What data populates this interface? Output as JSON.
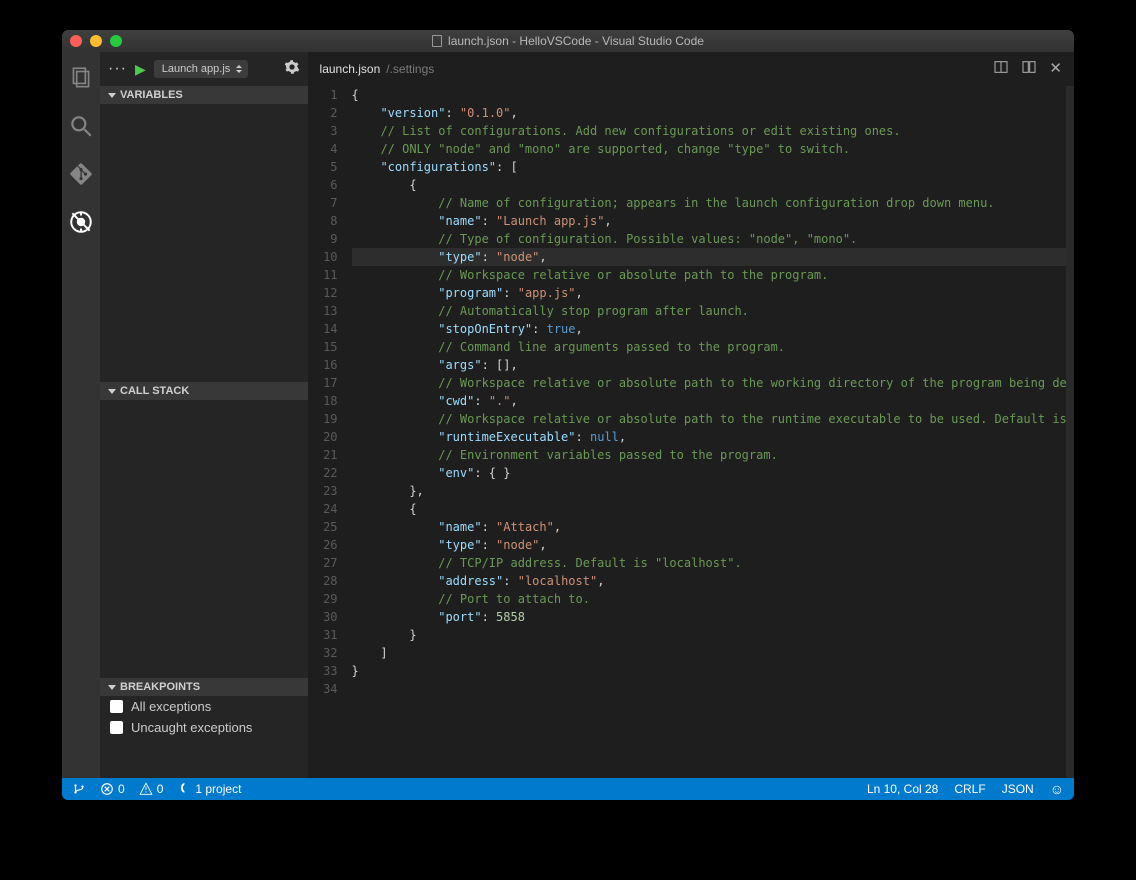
{
  "window": {
    "title": "launch.json - HelloVSCode - Visual Studio Code",
    "file_in_title": "launch.json"
  },
  "debugToolbar": {
    "configName": "Launch app.js"
  },
  "panels": {
    "variables": "VARIABLES",
    "callstack": "CALL STACK",
    "breakpoints": "BREAKPOINTS"
  },
  "breakpoints": [
    {
      "label": "All exceptions"
    },
    {
      "label": "Uncaught exceptions"
    }
  ],
  "editor": {
    "tabName": "launch.json",
    "tabPath": "/.settings",
    "highlightedLine": 10,
    "lines": [
      {
        "n": 1,
        "t": [
          {
            "c": "p",
            "v": "{"
          }
        ]
      },
      {
        "n": 2,
        "t": [
          {
            "c": "p",
            "v": "    "
          },
          {
            "c": "k",
            "v": "\"version\""
          },
          {
            "c": "p",
            "v": ": "
          },
          {
            "c": "s",
            "v": "\"0.1.0\""
          },
          {
            "c": "p",
            "v": ","
          }
        ]
      },
      {
        "n": 3,
        "t": [
          {
            "c": "p",
            "v": "    "
          },
          {
            "c": "c",
            "v": "// List of configurations. Add new configurations or edit existing ones."
          }
        ]
      },
      {
        "n": 4,
        "t": [
          {
            "c": "p",
            "v": "    "
          },
          {
            "c": "c",
            "v": "// ONLY \"node\" and \"mono\" are supported, change \"type\" to switch."
          }
        ]
      },
      {
        "n": 5,
        "t": [
          {
            "c": "p",
            "v": "    "
          },
          {
            "c": "k",
            "v": "\"configurations\""
          },
          {
            "c": "p",
            "v": ": ["
          }
        ]
      },
      {
        "n": 6,
        "t": [
          {
            "c": "p",
            "v": "        {"
          }
        ]
      },
      {
        "n": 7,
        "t": [
          {
            "c": "p",
            "v": "            "
          },
          {
            "c": "c",
            "v": "// Name of configuration; appears in the launch configuration drop down menu."
          }
        ]
      },
      {
        "n": 8,
        "t": [
          {
            "c": "p",
            "v": "            "
          },
          {
            "c": "k",
            "v": "\"name\""
          },
          {
            "c": "p",
            "v": ": "
          },
          {
            "c": "s",
            "v": "\"Launch app.js\""
          },
          {
            "c": "p",
            "v": ","
          }
        ]
      },
      {
        "n": 9,
        "t": [
          {
            "c": "p",
            "v": "            "
          },
          {
            "c": "c",
            "v": "// Type of configuration. Possible values: \"node\", \"mono\"."
          }
        ]
      },
      {
        "n": 10,
        "t": [
          {
            "c": "p",
            "v": "            "
          },
          {
            "c": "k",
            "v": "\"type\""
          },
          {
            "c": "p",
            "v": ": "
          },
          {
            "c": "s",
            "v": "\"node\""
          },
          {
            "c": "p",
            "v": ","
          }
        ]
      },
      {
        "n": 11,
        "t": [
          {
            "c": "p",
            "v": "            "
          },
          {
            "c": "c",
            "v": "// Workspace relative or absolute path to the program."
          }
        ]
      },
      {
        "n": 12,
        "t": [
          {
            "c": "p",
            "v": "            "
          },
          {
            "c": "k",
            "v": "\"program\""
          },
          {
            "c": "p",
            "v": ": "
          },
          {
            "c": "s",
            "v": "\"app.js\""
          },
          {
            "c": "p",
            "v": ","
          }
        ]
      },
      {
        "n": 13,
        "t": [
          {
            "c": "p",
            "v": "            "
          },
          {
            "c": "c",
            "v": "// Automatically stop program after launch."
          }
        ]
      },
      {
        "n": 14,
        "t": [
          {
            "c": "p",
            "v": "            "
          },
          {
            "c": "k",
            "v": "\"stopOnEntry\""
          },
          {
            "c": "p",
            "v": ": "
          },
          {
            "c": "b",
            "v": "true"
          },
          {
            "c": "p",
            "v": ","
          }
        ]
      },
      {
        "n": 15,
        "t": [
          {
            "c": "p",
            "v": "            "
          },
          {
            "c": "c",
            "v": "// Command line arguments passed to the program."
          }
        ]
      },
      {
        "n": 16,
        "t": [
          {
            "c": "p",
            "v": "            "
          },
          {
            "c": "k",
            "v": "\"args\""
          },
          {
            "c": "p",
            "v": ": [],"
          }
        ]
      },
      {
        "n": 17,
        "t": [
          {
            "c": "p",
            "v": "            "
          },
          {
            "c": "c",
            "v": "// Workspace relative or absolute path to the working directory of the program being deb"
          }
        ]
      },
      {
        "n": 18,
        "t": [
          {
            "c": "p",
            "v": "            "
          },
          {
            "c": "k",
            "v": "\"cwd\""
          },
          {
            "c": "p",
            "v": ": "
          },
          {
            "c": "s",
            "v": "\".\""
          },
          {
            "c": "p",
            "v": ","
          }
        ]
      },
      {
        "n": 19,
        "t": [
          {
            "c": "p",
            "v": "            "
          },
          {
            "c": "c",
            "v": "// Workspace relative or absolute path to the runtime executable to be used. Default is "
          }
        ]
      },
      {
        "n": 20,
        "t": [
          {
            "c": "p",
            "v": "            "
          },
          {
            "c": "k",
            "v": "\"runtimeExecutable\""
          },
          {
            "c": "p",
            "v": ": "
          },
          {
            "c": "b",
            "v": "null"
          },
          {
            "c": "p",
            "v": ","
          }
        ]
      },
      {
        "n": 21,
        "t": [
          {
            "c": "p",
            "v": "            "
          },
          {
            "c": "c",
            "v": "// Environment variables passed to the program."
          }
        ]
      },
      {
        "n": 22,
        "t": [
          {
            "c": "p",
            "v": "            "
          },
          {
            "c": "k",
            "v": "\"env\""
          },
          {
            "c": "p",
            "v": ": { }"
          }
        ]
      },
      {
        "n": 23,
        "t": [
          {
            "c": "p",
            "v": "        },"
          }
        ]
      },
      {
        "n": 24,
        "t": [
          {
            "c": "p",
            "v": "        {"
          }
        ]
      },
      {
        "n": 25,
        "t": [
          {
            "c": "p",
            "v": "            "
          },
          {
            "c": "k",
            "v": "\"name\""
          },
          {
            "c": "p",
            "v": ": "
          },
          {
            "c": "s",
            "v": "\"Attach\""
          },
          {
            "c": "p",
            "v": ","
          }
        ]
      },
      {
        "n": 26,
        "t": [
          {
            "c": "p",
            "v": "            "
          },
          {
            "c": "k",
            "v": "\"type\""
          },
          {
            "c": "p",
            "v": ": "
          },
          {
            "c": "s",
            "v": "\"node\""
          },
          {
            "c": "p",
            "v": ","
          }
        ]
      },
      {
        "n": 27,
        "t": [
          {
            "c": "p",
            "v": "            "
          },
          {
            "c": "c",
            "v": "// TCP/IP address. Default is \"localhost\"."
          }
        ]
      },
      {
        "n": 28,
        "t": [
          {
            "c": "p",
            "v": "            "
          },
          {
            "c": "k",
            "v": "\"address\""
          },
          {
            "c": "p",
            "v": ": "
          },
          {
            "c": "s",
            "v": "\"localhost\""
          },
          {
            "c": "p",
            "v": ","
          }
        ]
      },
      {
        "n": 29,
        "t": [
          {
            "c": "p",
            "v": "            "
          },
          {
            "c": "c",
            "v": "// Port to attach to."
          }
        ]
      },
      {
        "n": 30,
        "t": [
          {
            "c": "p",
            "v": "            "
          },
          {
            "c": "k",
            "v": "\"port\""
          },
          {
            "c": "p",
            "v": ": "
          },
          {
            "c": "n",
            "v": "5858"
          }
        ]
      },
      {
        "n": 31,
        "t": [
          {
            "c": "p",
            "v": "        }"
          }
        ]
      },
      {
        "n": 32,
        "t": [
          {
            "c": "p",
            "v": "    ]"
          }
        ]
      },
      {
        "n": 33,
        "t": [
          {
            "c": "p",
            "v": "}"
          }
        ]
      },
      {
        "n": 34,
        "t": []
      }
    ]
  },
  "statusBar": {
    "errors": "0",
    "warnings": "0",
    "projects": "1 project",
    "cursor": "Ln 10, Col 28",
    "eol": "CRLF",
    "language": "JSON"
  }
}
